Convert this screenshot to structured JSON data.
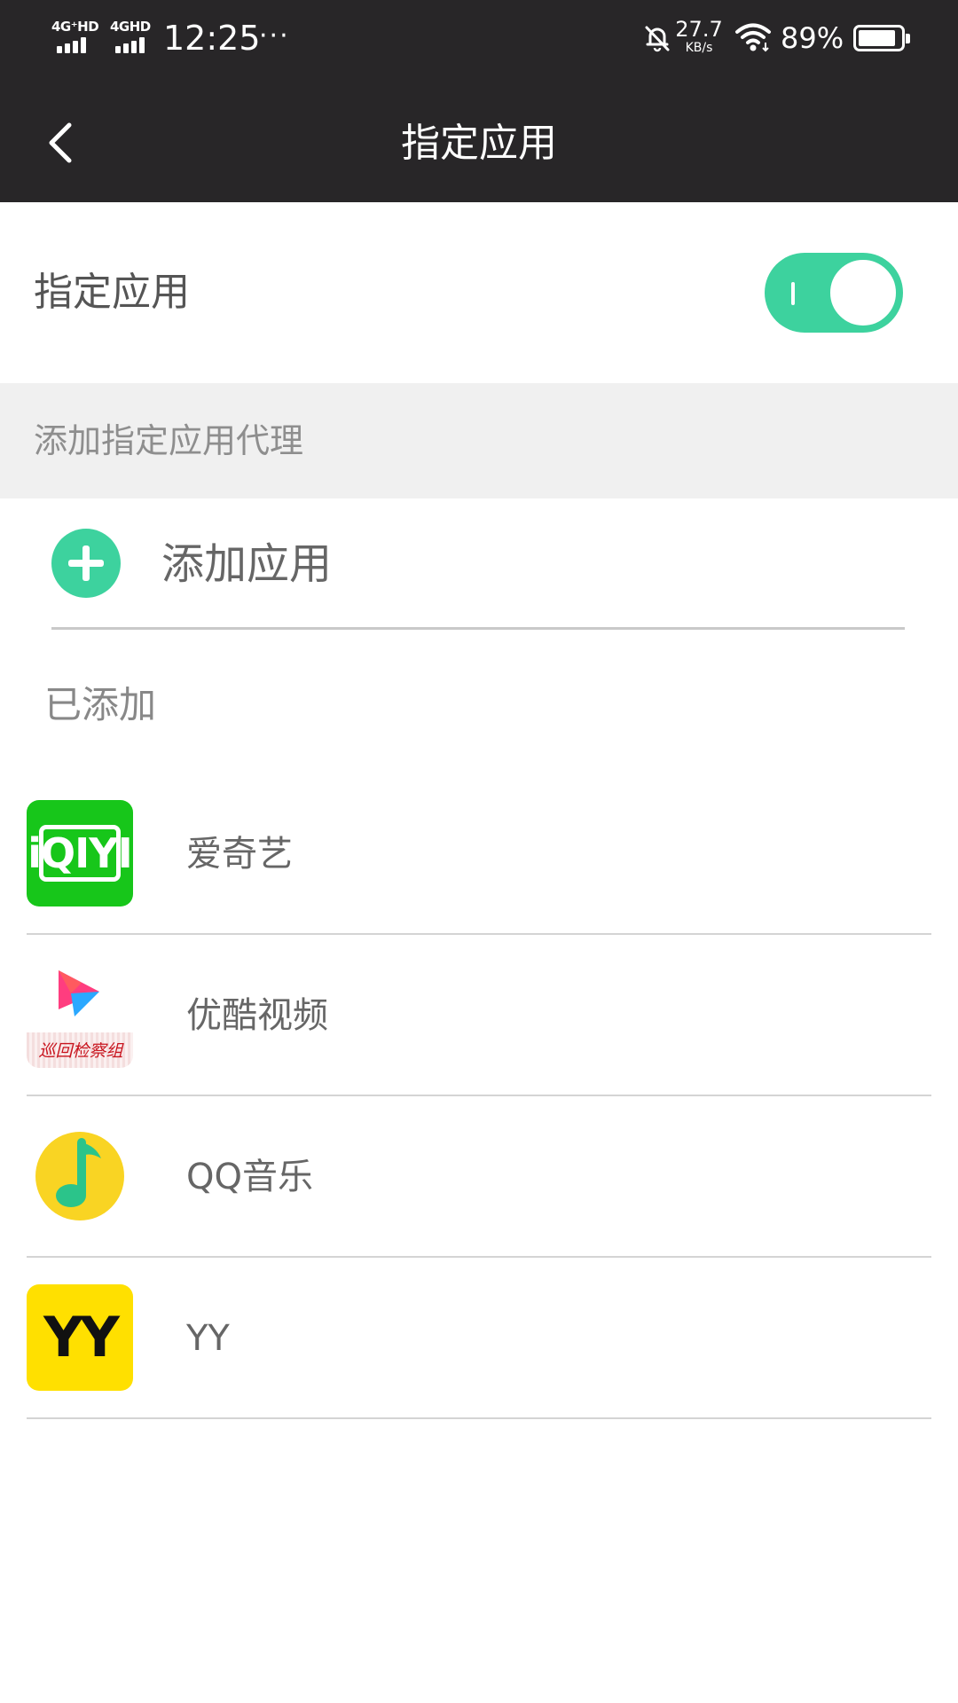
{
  "status_bar": {
    "signal_1": "4G⁺HD",
    "signal_2": "4GHD",
    "time": "12:25",
    "more": "···",
    "net_speed": "27.7",
    "net_speed_unit": "KB/s",
    "battery_text": "89%",
    "battery_level": 0.89
  },
  "header": {
    "title": "指定应用"
  },
  "toggle": {
    "label": "指定应用",
    "state": "on",
    "accent_color": "#3dd29e"
  },
  "section": {
    "title": "添加指定应用代理"
  },
  "add_app": {
    "label": "添加应用",
    "icon": "plus-circle-icon"
  },
  "added": {
    "title": "已添加",
    "apps": [
      {
        "name": "爱奇艺",
        "icon": "iqiyi-app-icon",
        "icon_text": "iQIYI"
      },
      {
        "name": "优酷视频",
        "icon": "youku-app-icon",
        "watermark": "巡回检察组"
      },
      {
        "name": "QQ音乐",
        "icon": "qq-music-app-icon"
      },
      {
        "name": "YY",
        "icon": "yy-app-icon",
        "icon_text": "YY"
      }
    ]
  },
  "colors": {
    "bar_background": "#282628",
    "section_background": "#f0f0f0",
    "iqiyi_green": "#17c61a",
    "yy_yellow": "#ffe000"
  }
}
